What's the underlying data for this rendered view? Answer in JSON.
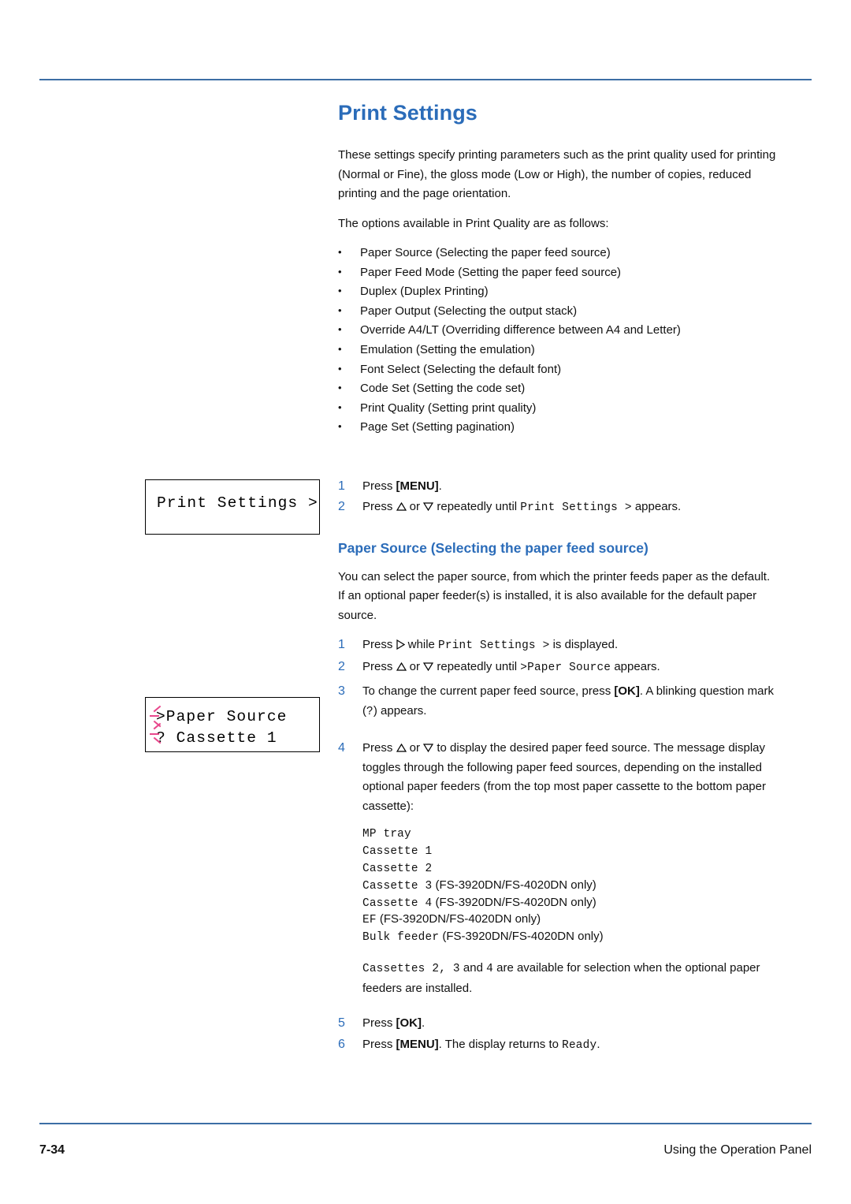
{
  "document": {
    "title": "Print Settings",
    "intro_paragraphs": [
      "These settings specify printing parameters such as the print quality used for printing (Normal or Fine), the gloss mode (Low or High), the number of copies, reduced printing and the page orientation.",
      "The options available in Print Quality are as follows:"
    ],
    "bullets": [
      "Paper Source (Selecting the paper feed source)",
      "Paper Feed Mode (Setting the paper feed source)",
      "Duplex (Duplex Printing)",
      "Paper Output (Selecting the output stack)",
      "Override A4/LT (Overriding difference between A4 and Letter)",
      "Emulation (Setting the emulation)",
      "Font Select (Selecting the default font)",
      "Code Set (Setting the code set)",
      "Print Quality (Setting print quality)",
      "Page Set (Setting pagination)"
    ],
    "steps_first": {
      "step1_prefix": "Press ",
      "step1_key": "[MENU]",
      "step1_suffix": ".",
      "step2_prefix": "Press ",
      "step2_mid": " or ",
      "step2_after": " repeatedly until ",
      "step2_mono": "Print Settings >",
      "step2_tail": " appears."
    },
    "lcd_print_settings": "Print Settings >",
    "subtitle": "Paper Source (Selecting the paper feed source)",
    "section_paragraph": "You can select the paper source, from which the printer feeds paper as the default. If an optional paper feeder(s) is installed, it is also available for the default paper source.",
    "lcd_paper_source": {
      "line1": ">Paper Source",
      "line2": "? Cassette 1"
    },
    "steps_second": {
      "s1_pre": "Press ",
      "s1_mid": " while ",
      "s1_mono": "Print Settings >",
      "s1_tail": " is displayed.",
      "s2_pre": "Press ",
      "s2_mid": " or ",
      "s2_after": " repeatedly until ",
      "s2_mono": ">Paper Source",
      "s2_tail": " appears.",
      "s3_pre": "To change the current paper feed source, press ",
      "s3_key": "[OK]",
      "s3_mid": ". A blinking question mark (",
      "s3_mono": "?",
      "s3_tail": ") appears.",
      "s4_pre": "Press ",
      "s4_mid": " or ",
      "s4_tail": " to display the desired paper feed source. The message display toggles through the following paper feed sources, depending on the installed optional paper feeders (from the top most paper cassette to the bottom paper cassette):",
      "s5_pre": "Press ",
      "s5_key": "[OK]",
      "s5_tail": ".",
      "s6_pre": "Press ",
      "s6_key": "[MENU]",
      "s6_mid": ". The display returns to ",
      "s6_mono": "Ready",
      "s6_tail": "."
    },
    "paper_sources": [
      {
        "name": "MP tray",
        "note": ""
      },
      {
        "name": "Cassette 1",
        "note": ""
      },
      {
        "name": "Cassette 2",
        "note": ""
      },
      {
        "name": "Cassette 3",
        "note": "(FS-3920DN/FS-4020DN only)"
      },
      {
        "name": "Cassette 4",
        "note": "(FS-3920DN/FS-4020DN only)"
      },
      {
        "name": "EF",
        "note": "(FS-3920DN/FS-4020DN only)"
      },
      {
        "name": "Bulk feeder",
        "note": "(FS-3920DN/FS-4020DN only)"
      }
    ],
    "note": {
      "mono1": "Cassettes 2",
      "sep1": ", ",
      "mono2": "3",
      "sep2": " and ",
      "mono3": "4",
      "tail": " are available for selection when the optional paper feeders are installed."
    },
    "footer": {
      "page_number": "7-34",
      "chapter": "Using the Operation Panel"
    },
    "colors": {
      "accent": "#2b6cb9",
      "rule": "#3c6ea5",
      "blink": "#e8488c"
    }
  }
}
